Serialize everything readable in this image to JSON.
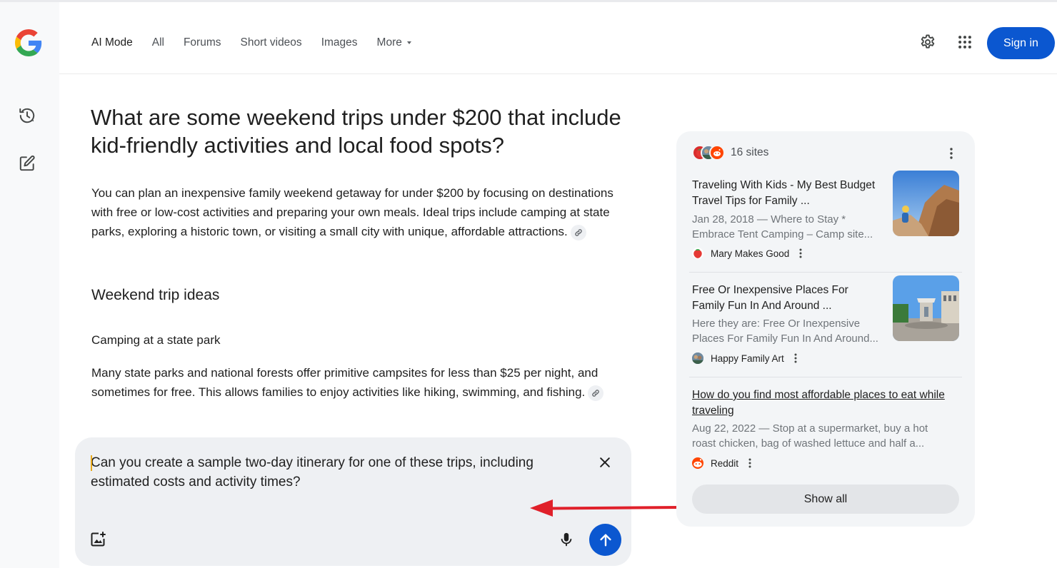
{
  "nav": {
    "tabs": [
      {
        "label": "AI Mode"
      },
      {
        "label": "All"
      },
      {
        "label": "Forums"
      },
      {
        "label": "Short videos"
      },
      {
        "label": "Images"
      },
      {
        "label": "More"
      }
    ]
  },
  "header": {
    "sign_in_label": "Sign in"
  },
  "leftrail": {
    "icons": [
      "history-icon",
      "new-chat-icon"
    ]
  },
  "main": {
    "question": "What are some weekend trips under $200 that include kid-friendly activities and local food spots?",
    "intro": "You can plan an inexpensive family weekend getaway for under $200 by focusing on destinations with free or low-cost activities and preparing your own meals. Ideal trips include camping at state parks, exploring a historic town, or visiting a small city with unique, affordable attractions.",
    "section_heading": "Weekend trip ideas",
    "subsection_heading": "Camping at a state park",
    "subsection_text": "Many state parks and national forests offer primitive campsites for less than $25 per night, and sometimes for free. This allows families to enjoy activities like hiking, swimming, and fishing."
  },
  "composer": {
    "text": "Can you create a sample two-day itinerary for one of these trips, including estimated costs and activity times?"
  },
  "sources": {
    "count_label": "16 sites",
    "items": [
      {
        "title": "Traveling With Kids - My Best Budget Travel Tips for Family ...",
        "snippet": "Jan 28, 2018 — Where to Stay * Embrace Tent Camping – Camp site...",
        "site": "Mary Makes Good"
      },
      {
        "title": "Free Or Inexpensive Places For Family Fun In And Around ...",
        "snippet": "Here they are: Free Or Inexpensive Places For Family Fun In And Around...",
        "site": "Happy Family Art"
      },
      {
        "title": "How do you find most affordable places to eat while traveling",
        "snippet": "Aug 22, 2022 — Stop at a supermarket, buy a hot roast chicken, bag of washed lettuce and half a...",
        "site": "Reddit"
      }
    ],
    "show_all_label": "Show all"
  },
  "colors": {
    "accent": "#0b57d0",
    "annotation_arrow": "#e0202a"
  }
}
